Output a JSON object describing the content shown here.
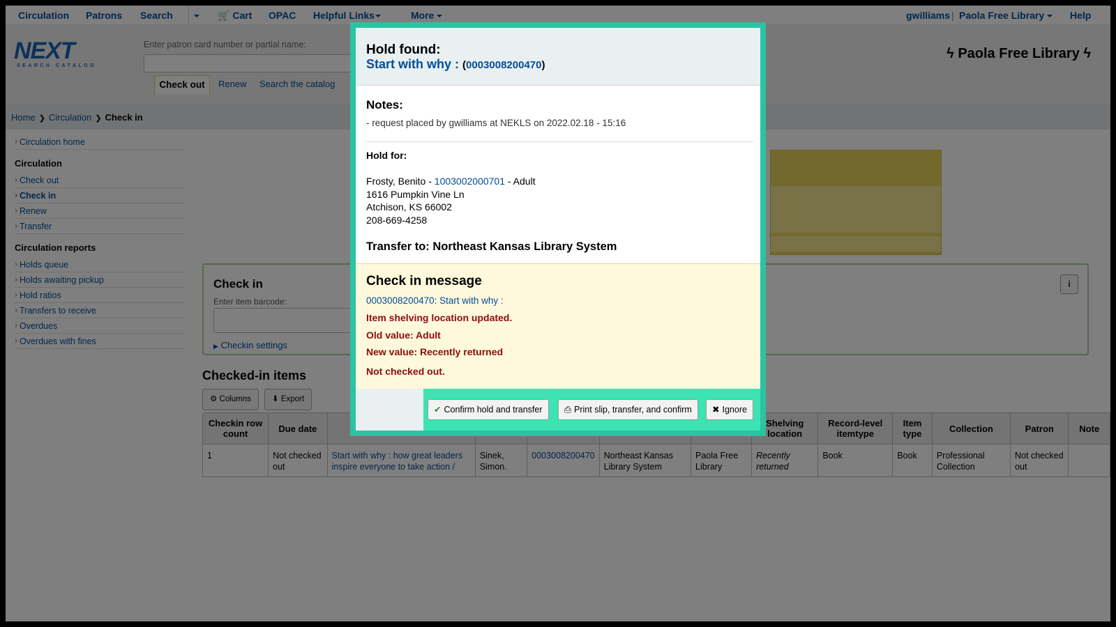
{
  "topnav": {
    "items": [
      "Circulation",
      "Patrons",
      "Search",
      "Cart",
      "OPAC",
      "Helpful Links",
      "More"
    ],
    "user": "gwilliams",
    "separator": "|",
    "branch": "Paola Free Library",
    "help": "Help"
  },
  "header": {
    "logo_main": "NEXT",
    "logo_sub": "SEARCH CATALOG",
    "search_label": "Enter patron card number or partial name:",
    "search_value": "",
    "tabs": [
      "Check out",
      "Renew",
      "Search the catalog"
    ],
    "library_title": "Paola Free Library"
  },
  "breadcrumbs": [
    "Home",
    "Circulation",
    "Check in"
  ],
  "sidebar": {
    "top_link": "Circulation home",
    "heading1": "Circulation",
    "items1": [
      "Check out",
      "Check in",
      "Renew",
      "Transfer"
    ],
    "heading2": "Circulation reports",
    "items2": [
      "Holds queue",
      "Holds awaiting pickup",
      "Hold ratios",
      "Transfers to receive",
      "Overdues",
      "Overdues with fines"
    ]
  },
  "checkin": {
    "title": "Check in",
    "barcode_label": "Enter item barcode:",
    "barcode_value": "",
    "settings": "Checkin settings",
    "info_icon": "i"
  },
  "checked_in": {
    "title": "Checked-in items",
    "columns_button": "Columns",
    "export_button": "Export",
    "headers": [
      "Checkin row count",
      "Due date",
      "",
      "",
      "",
      "",
      "",
      "Shelving location",
      "Record-level itemtype",
      "Item type",
      "Collection",
      "Patron",
      "Note"
    ],
    "row": [
      "1",
      "Not checked out",
      "Start with why : how great leaders inspire everyone to take action /",
      "Sinek, Simon.",
      "0003008200470",
      "Northeast Kansas Library System",
      "Paola Free Library",
      "Recently returned",
      "Book",
      "Book",
      "Professional Collection",
      "Not checked out",
      ""
    ]
  },
  "modal": {
    "title": "Hold found:",
    "item_title": "Start with why :",
    "paren_open": "(",
    "barcode": "0003008200470",
    "paren_close": ")",
    "notes_title": "Notes:",
    "notes_text": "- request placed by gwilliams at NEKLS on 2022.02.18 - 15:16",
    "hold_for_label": "Hold for:",
    "patron_name": "Frosty, Benito -",
    "patron_card": "1003002000701",
    "patron_category": "- Adult",
    "address1": "1616 Pumpkin Vine Ln",
    "address2": "Atchison, KS 66002",
    "phone": "208-669-4258",
    "transfer_to": "Transfer to: Northeast Kansas Library System",
    "checkin_message_title": "Check in message",
    "checkin_message_link": "0003008200470: Start with why :",
    "msg_location_updated": "Item shelving location updated.",
    "msg_old_value": "Old value: Adult",
    "msg_new_value": "New value: Recently returned",
    "msg_not_checked_out": "Not checked out.",
    "btn_confirm": "Confirm hold and transfer",
    "btn_print": "Print slip, transfer, and confirm",
    "btn_ignore": "Ignore"
  },
  "colors": {
    "link": "#004d99",
    "modal_border": "#2bc3a1",
    "modal_footer_bar": "#3de3b3",
    "message_bg": "#fef8dd",
    "error_text": "#8c0d0d"
  }
}
